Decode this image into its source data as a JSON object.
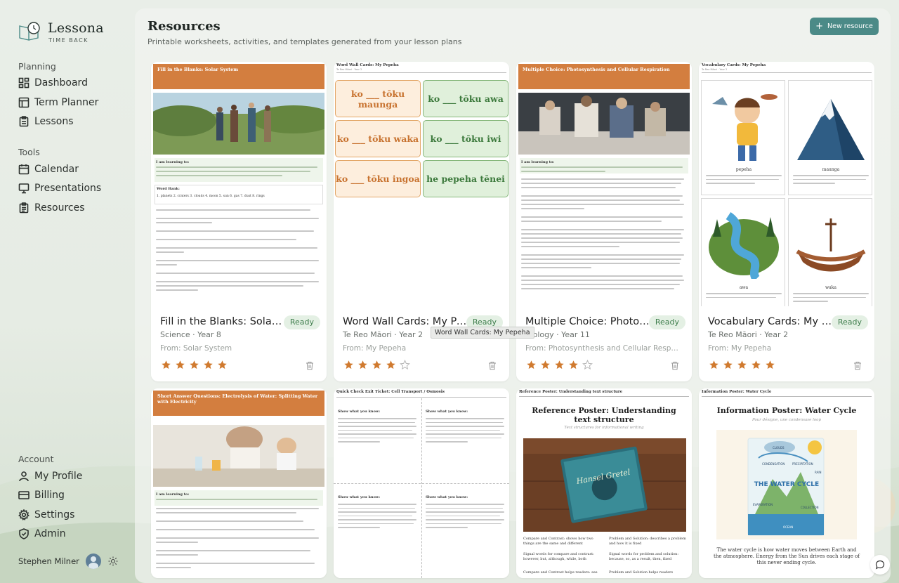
{
  "brand": {
    "name": "Lessona",
    "tagline": "TIME BACK"
  },
  "nav": {
    "planning_heading": "Planning",
    "planning": [
      {
        "label": "Dashboard",
        "icon": "dashboard-icon"
      },
      {
        "label": "Term Planner",
        "icon": "term-planner-icon"
      },
      {
        "label": "Lessons",
        "icon": "lessons-icon"
      }
    ],
    "tools_heading": "Tools",
    "tools": [
      {
        "label": "Calendar",
        "icon": "calendar-icon"
      },
      {
        "label": "Presentations",
        "icon": "presentations-icon"
      },
      {
        "label": "Resources",
        "icon": "resources-icon",
        "active": true
      }
    ],
    "account_heading": "Account",
    "account": [
      {
        "label": "My Profile",
        "icon": "user-icon"
      },
      {
        "label": "Billing",
        "icon": "billing-icon"
      },
      {
        "label": "Settings",
        "icon": "gear-icon"
      },
      {
        "label": "Admin",
        "icon": "shield-icon"
      }
    ]
  },
  "user": {
    "name": "Stephen Milner"
  },
  "page": {
    "title": "Resources",
    "subtitle": "Printable worksheets, activities, and templates generated from your lesson plans",
    "new_button": "New resource"
  },
  "colors": {
    "accent": "#4b8a87",
    "worksheet_header": "#d37e3f",
    "ready_bg": "#e4f0e4",
    "ready_text": "#3f7e4d",
    "star": "#d07a2f"
  },
  "cards": [
    {
      "title": "Fill in the Blanks: Solar System",
      "status": "Ready",
      "meta": "Science · Year 8",
      "from": "From: Solar System",
      "rating": 5,
      "thumb": {
        "header": "Fill in the Blanks: Solar System",
        "learning": "I am learning to:",
        "word_bank": "Word Bank:",
        "words": "1. planets  2. craters  3. clouds  4. moon  5. sun  6. gas  7. dust  8. rings"
      }
    },
    {
      "title": "Word Wall Cards: My Pepeha",
      "status": "Ready",
      "meta": "Te Reo Māori · Year 2",
      "from": "From: My Pepeha",
      "rating": 4,
      "thumb": {
        "header": "Word Wall Cards: My Pepeha",
        "sub": "Te Reo Māori · Year 2",
        "words": [
          {
            "text": "ko ___ tōku maunga",
            "style": "peach"
          },
          {
            "text": "ko ___ tōku awa",
            "style": "green"
          },
          {
            "text": "ko ___ tōku waka",
            "style": "peach"
          },
          {
            "text": "ko ___ tōku iwi",
            "style": "green"
          },
          {
            "text": "ko ___ tōku ingoa",
            "style": "peach"
          },
          {
            "text": "he pepeha tēnei",
            "style": "green"
          }
        ]
      }
    },
    {
      "title": "Multiple Choice: Photosynthesis and Cellular Respiration",
      "status": "Ready",
      "meta": "Biology · Year 11",
      "from": "From: Photosynthesis and Cellular Respiration",
      "rating": 4,
      "thumb": {
        "header": "Multiple Choice: Photosynthesis and Cellular Respiration",
        "learning": "I am learning to:"
      }
    },
    {
      "title": "Vocabulary Cards: My Pepeha",
      "status": "Ready",
      "meta": "Te Reo Māori · Year 2",
      "from": "From: My Pepeha",
      "rating": 5,
      "thumb": {
        "header": "Vocabulary Cards: My Pepeha",
        "sub": "Te Reo Māori · Year 2",
        "words": [
          "pepeha",
          "maunga",
          "awa",
          "waka"
        ]
      }
    },
    {
      "title": "Short Answer Questions: Electrolysis of Water: Splitting Water with Electricity",
      "thumb": {
        "header": "Short Answer Questions: Electrolysis of Water: Splitting Water with Electricity",
        "learning": "I am learning to:"
      }
    },
    {
      "title": "Quick Check Exit Ticket: Cell Transport / Osmosis",
      "thumb": {
        "header": "Quick Check Exit Ticket: Cell Transport / Osmosis",
        "prompt": "Show what you know:"
      }
    },
    {
      "title": "Reference Poster: Understanding text structure",
      "thumb": {
        "header": "Reference Poster: Understanding text structure",
        "title": "Reference Poster: Understanding text structure",
        "sub": "Text structures for informational writing",
        "book": "Hansel Gretel",
        "items": [
          "Compare and Contrast: shows how two things are the same and different",
          "Problem and Solution: describes a problem and how it is fixed",
          "Signal words for compare and contrast: however, but, although, while, both",
          "Signal words for problem and solution: because, so, as a result, then, fixed",
          "Compare and Contrast helps readers: see",
          "Problem and Solution helps readers"
        ]
      }
    },
    {
      "title": "Information Poster: Water Cycle",
      "thumb": {
        "header": "Information Poster: Water Cycle",
        "title": "Information Poster: Water Cycle",
        "sub": "Pour désigne, une condensase loop",
        "diagram_title": "THE WATER CYCLE",
        "diagram_labels": [
          "CONDENSATION",
          "PRECIPITATION",
          "EVAPORATION",
          "COLLECTION",
          "OCEAN",
          "CLOUDS",
          "RAIN"
        ],
        "caption": "The water cycle is how water moves between Earth and the atmosphere. Energy from the Sun drives each stage of this never ending cycle."
      }
    }
  ],
  "tooltip": "Word Wall Cards: My Pepeha"
}
